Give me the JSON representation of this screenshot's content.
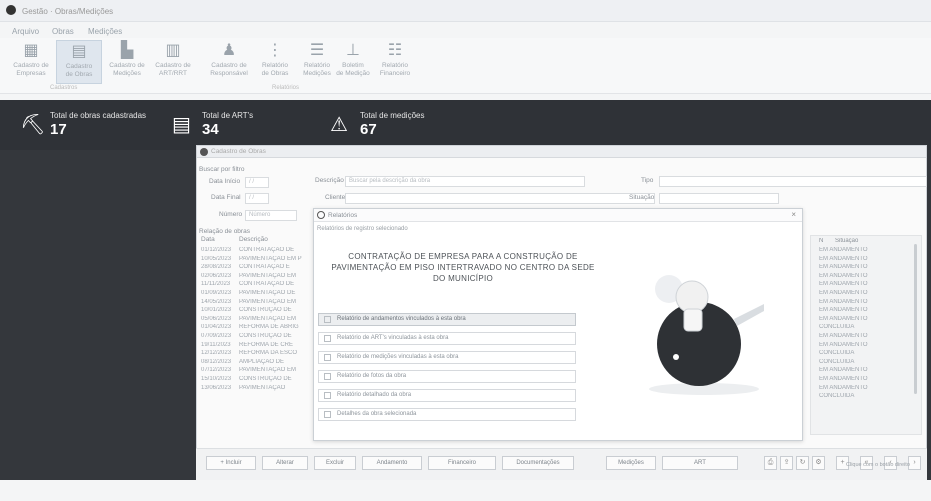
{
  "app": {
    "title": "Gestão · Obras/Medições"
  },
  "tabs": [
    "Arquivo",
    "Obras",
    "Medições"
  ],
  "ribbon": {
    "buttons": [
      {
        "label": "Cadastro de\nEmpresas",
        "icon": "building-icon"
      },
      {
        "label": "Cadastro\nde Obras",
        "icon": "document-icon",
        "selected": true
      },
      {
        "label": "Cadastro de\nMedições",
        "icon": "chart-icon"
      },
      {
        "label": "Cadastro de\nART/RRT",
        "icon": "file-icon"
      },
      {
        "label": "Cadastro de\nResponsável",
        "icon": "person-icon"
      },
      {
        "label": "Relatório\nde Obras",
        "icon": "report-icon"
      },
      {
        "label": "Relatório\nMedições",
        "icon": "list-icon"
      },
      {
        "label": "Boletim\nde Medição",
        "icon": "sheet-icon"
      },
      {
        "label": "Relatório\nFinanceiro",
        "icon": "table-icon"
      }
    ],
    "groups": [
      "Cadastros",
      "Relatórios"
    ]
  },
  "stats": [
    {
      "label": "Total de obras cadastradas",
      "value": "17",
      "icon": "worker-icon"
    },
    {
      "label": "Total de ART's",
      "value": "34",
      "icon": "file-list-icon"
    },
    {
      "label": "Total de medições",
      "value": "67",
      "icon": "warning-cone-icon"
    }
  ],
  "window": {
    "title": "Cadastro de Obras",
    "filter_title": "Buscar por filtro",
    "date_start_label": "Data Início",
    "date_end_label": "Data Final",
    "number_label": "Número",
    "description_label": "Descrição",
    "description_value": "Buscar pela descrição da obra",
    "client_label": "Cliente",
    "type_label": "Tipo",
    "situation_label": "Situação",
    "list_title": "Relação de obras",
    "date_placeholder": "  /  /",
    "number_placeholder": "Número"
  },
  "list": {
    "headers": [
      "Data",
      "Descrição"
    ],
    "rows": [
      [
        "01/12/2023",
        "CONTRATAÇÃO DE"
      ],
      [
        "10/05/2023",
        "PAVIMENTAÇÃO EM P"
      ],
      [
        "28/08/2023",
        "CONTRATAÇÃO E"
      ],
      [
        "02/06/2023",
        "PAVIMENTAÇÃO EM"
      ],
      [
        "11/11/2023",
        "CONTRATAÇÃO DE"
      ],
      [
        "01/09/2023",
        "PAVIMENTAÇÃO DE"
      ],
      [
        "14/05/2023",
        "PAVIMENTAÇÃO EM"
      ],
      [
        "10/01/2023",
        "CONSTRUÇÃO DE"
      ],
      [
        "05/06/2023",
        "PAVIMENTAÇÃO EM"
      ],
      [
        "01/04/2023",
        "REFORMA DE ABRIG"
      ],
      [
        "07/09/2023",
        "CONSTRUÇÃO DE"
      ],
      [
        "19/11/2023",
        "REFORMA DE CRE"
      ],
      [
        "12/12/2023",
        "REFORMA DA ESCO"
      ],
      [
        "08/12/2023",
        "AMPLIAÇÃO DE"
      ],
      [
        "07/12/2023",
        "PAVIMENTAÇÃO EM"
      ],
      [
        "15/10/2023",
        "CONSTRUÇÃO DE"
      ],
      [
        "13/06/2023",
        "PAVIMENTAÇÃO"
      ]
    ]
  },
  "right_list": {
    "headers": [
      "N",
      "Situação"
    ],
    "rows": [
      "EM ANDAMENTO",
      "EM ANDAMENTO",
      "EM ANDAMENTO",
      "EM ANDAMENTO",
      "EM ANDAMENTO",
      "EM ANDAMENTO",
      "EM ANDAMENTO",
      "EM ANDAMENTO",
      "EM ANDAMENTO",
      "CONCLUÍDA",
      "EM ANDAMENTO",
      "EM ANDAMENTO",
      "CONCLUÍDA",
      "CONCLUÍDA",
      "EM ANDAMENTO",
      "EM ANDAMENTO",
      "EM ANDAMENTO",
      "CONCLUÍDA"
    ]
  },
  "dialog": {
    "title": "Relatórios",
    "subtitle": "Relatórios de registro selecionado",
    "headline": "CONTRATAÇÃO DE EMPRESA PARA A CONSTRUÇÃO DE PAVIMENTAÇÃO EM PISO INTERTRAVADO NO CENTRO DA SEDE DO MUNICÍPIO",
    "options": [
      "Relatório de andamentos vinculados à esta obra",
      "Relatório de ART's vinculadas à esta obra",
      "Relatório de medições vinculadas à esta obra",
      "Relatório de fotos da obra",
      "Relatório detalhado da obra",
      "Detalhes da obra selecionada"
    ]
  },
  "toolbar": {
    "buttons": [
      "+ Incluir",
      "Alterar",
      "Excluir",
      "Andamento",
      "Financeiro",
      "Documentações",
      "Medições",
      "ART"
    ],
    "icon_buttons": [
      "print-icon",
      "export-icon",
      "refresh-icon",
      "settings-icon",
      "add-icon",
      "first-icon",
      "prev-icon",
      "next-icon"
    ],
    "footnote": "Clique com o botão direito"
  }
}
